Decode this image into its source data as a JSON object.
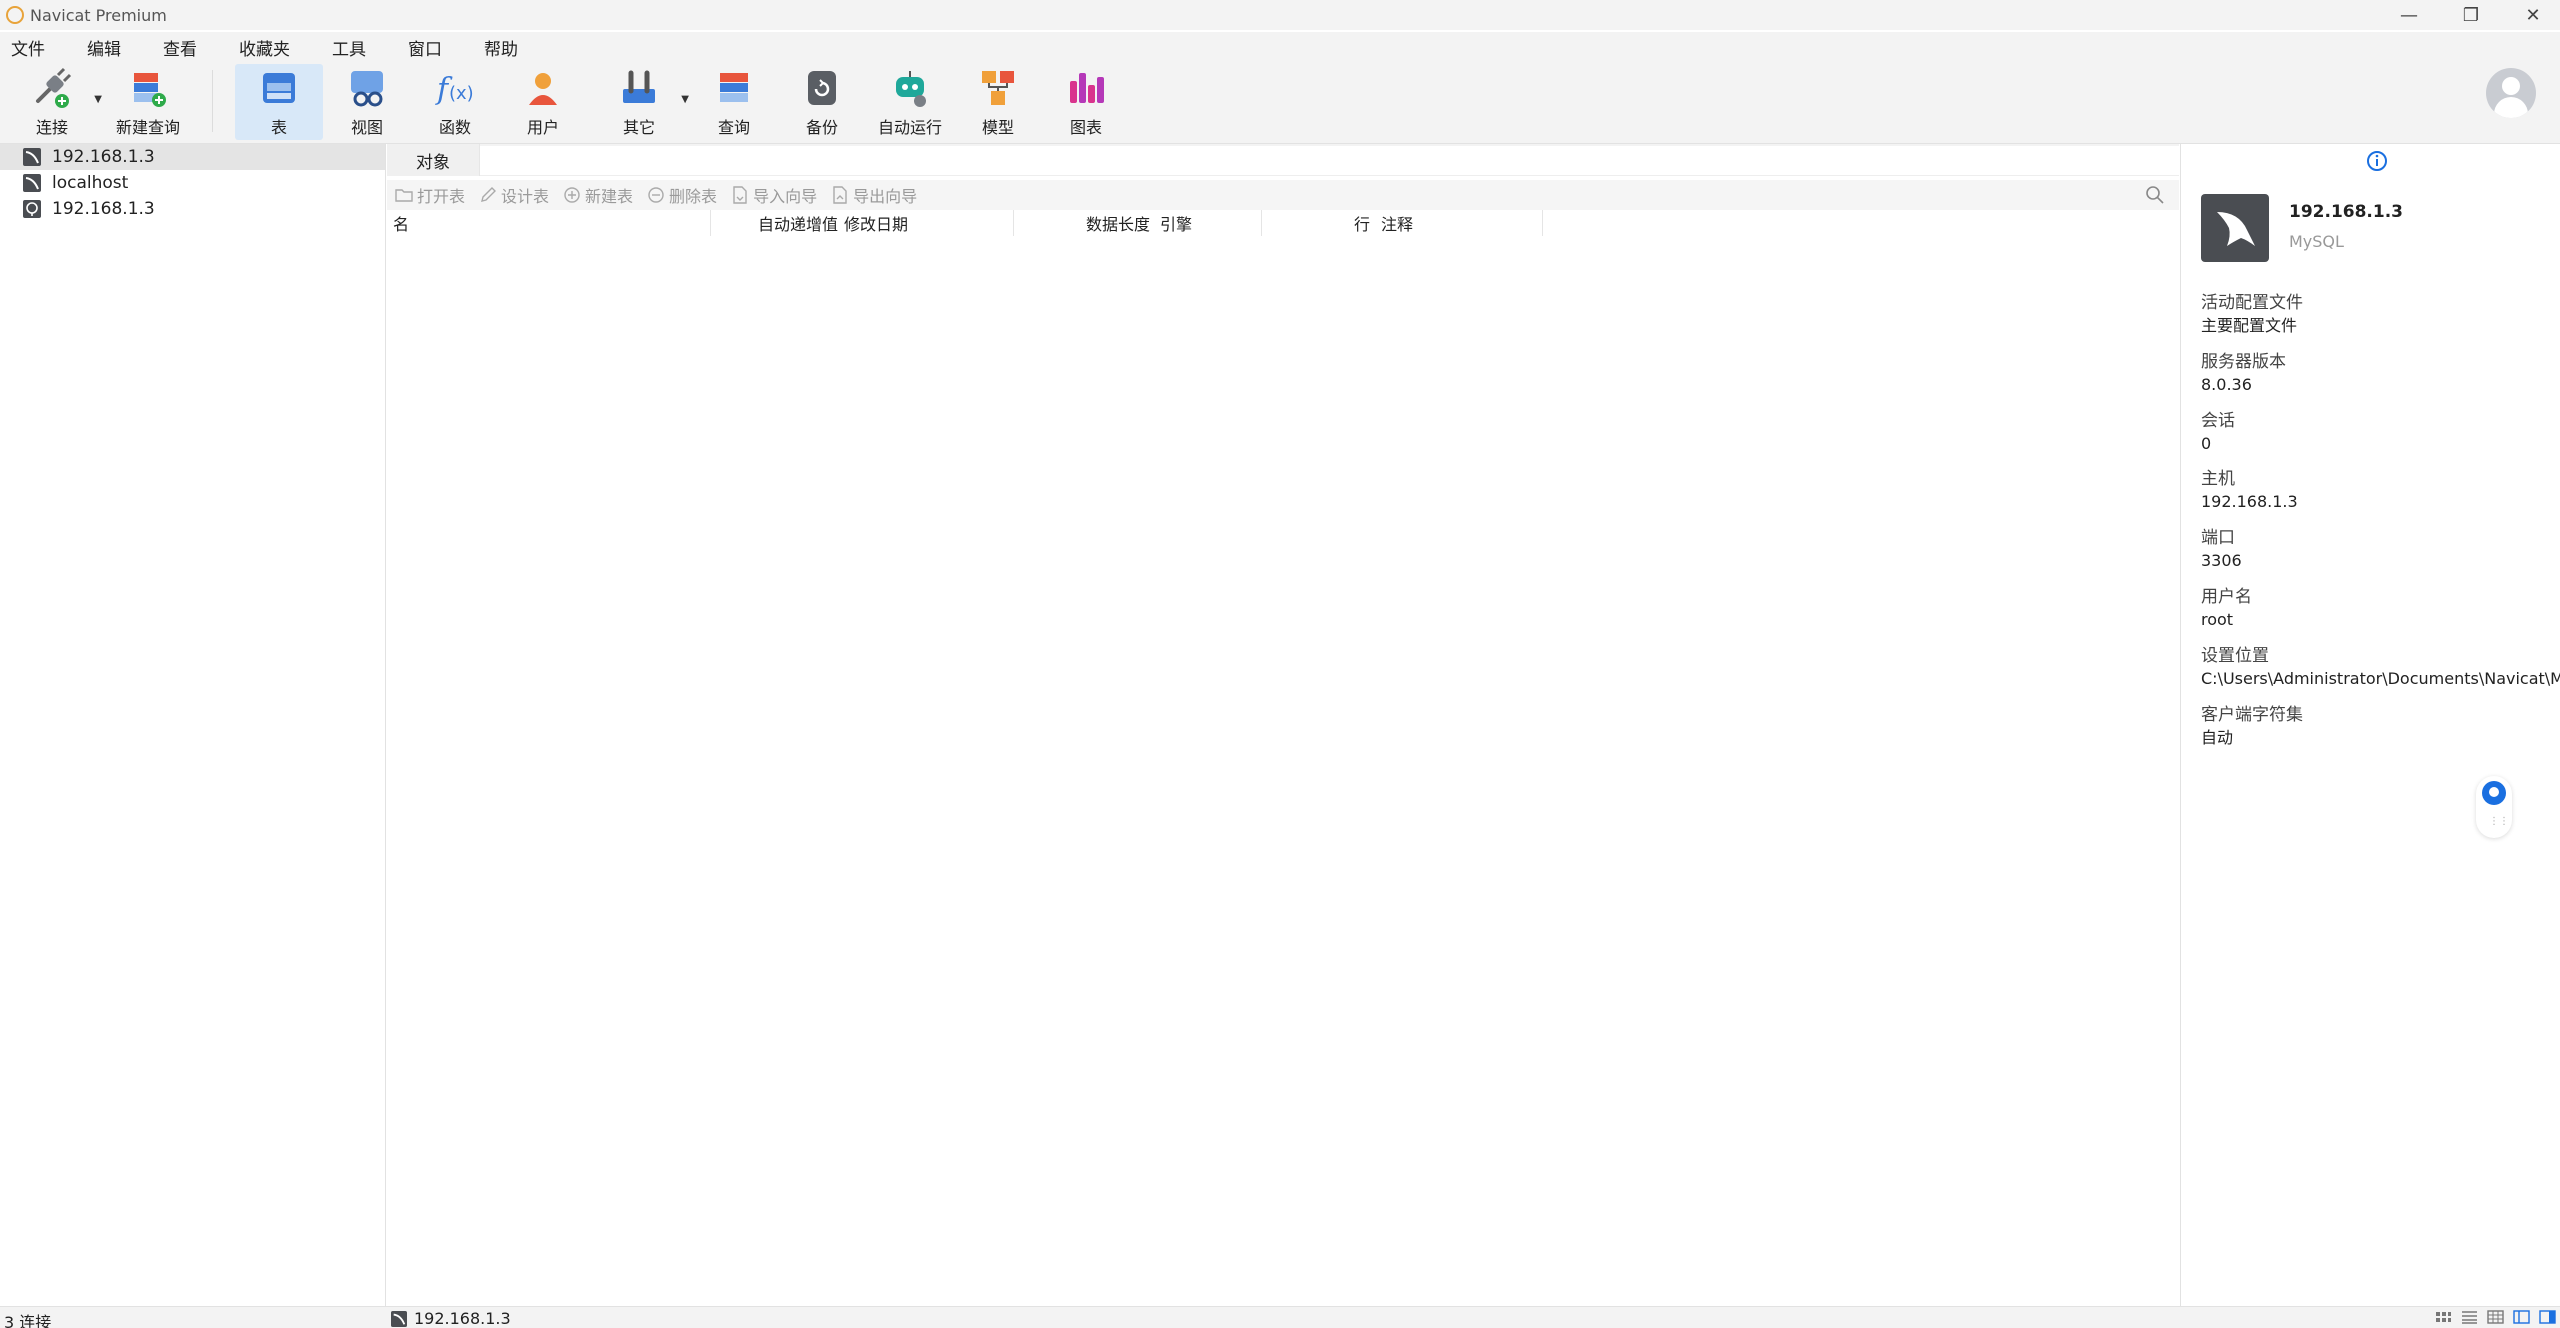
{
  "window": {
    "title": "Navicat Premium"
  },
  "menu": [
    "文件",
    "编辑",
    "查看",
    "收藏夹",
    "工具",
    "窗口",
    "帮助"
  ],
  "toolbar": {
    "connect": "连接",
    "new_query": "新建查询",
    "table": "表",
    "view": "视图",
    "function": "函数",
    "user": "用户",
    "other": "其它",
    "query": "查询",
    "backup": "备份",
    "automation": "自动运行",
    "model": "模型",
    "chart": "图表"
  },
  "nav": {
    "connections": [
      {
        "name": "192.168.1.3"
      },
      {
        "name": "localhost"
      },
      {
        "name": "192.168.1.3"
      }
    ]
  },
  "main": {
    "tab": "对象",
    "actions": {
      "open": "打开表",
      "design": "设计表",
      "new": "新建表",
      "delete": "删除表",
      "import": "导入向导",
      "export": "导出向导"
    },
    "columns": [
      "名",
      "自动递增值",
      "修改日期",
      "数据长度",
      "引擎",
      "行",
      "注释"
    ]
  },
  "info": {
    "name": "192.168.1.3",
    "type": "MySQL",
    "fields": [
      {
        "key": "活动配置文件",
        "value": "主要配置文件"
      },
      {
        "key": "服务器版本",
        "value": "8.0.36"
      },
      {
        "key": "会话",
        "value": "0"
      },
      {
        "key": "主机",
        "value": "192.168.1.3"
      },
      {
        "key": "端口",
        "value": "3306"
      },
      {
        "key": "用户名",
        "value": "root"
      },
      {
        "key": "设置位置",
        "value": "C:\\Users\\Administrator\\Documents\\Navicat\\M"
      },
      {
        "key": "客户端字符集",
        "value": "自动"
      }
    ]
  },
  "status": {
    "connections": "3 连接",
    "current": "192.168.1.3"
  },
  "colors": {
    "accent": "#1a6fe0",
    "selected_tool": "#d8e8f8"
  }
}
